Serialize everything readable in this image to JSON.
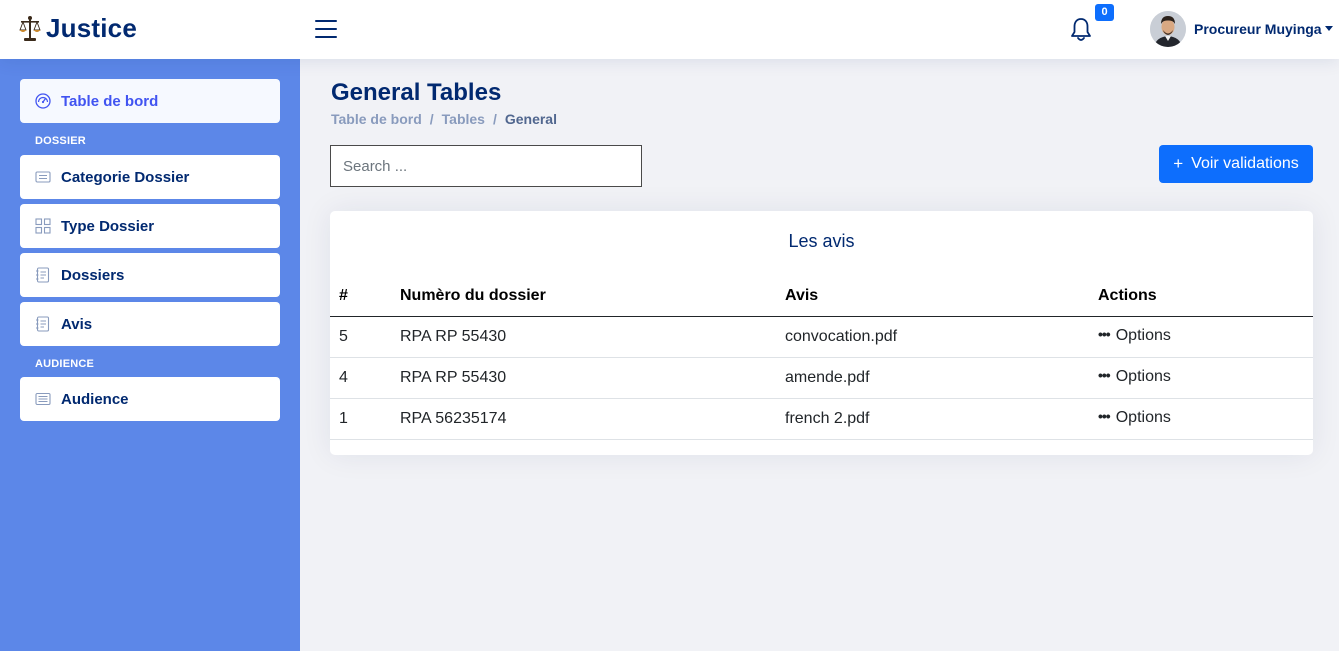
{
  "header": {
    "logo_text": "Justice",
    "notification_count": "0",
    "user_name": "Procureur Muyinga"
  },
  "sidebar": {
    "items": [
      {
        "label": "Table de bord",
        "icon": "gauge-icon",
        "active": true
      },
      {
        "label": "Categorie Dossier",
        "icon": "card-list-icon"
      },
      {
        "label": "Type Dossier",
        "icon": "grid-icon"
      },
      {
        "label": "Dossiers",
        "icon": "journal-text-icon"
      },
      {
        "label": "Avis",
        "icon": "journal-text-icon"
      },
      {
        "label": "Audience",
        "icon": "list-box-icon"
      }
    ],
    "headings": [
      "DOSSIER",
      "AUDIENCE"
    ]
  },
  "main": {
    "title": "General Tables",
    "breadcrumb": [
      "Table de bord",
      "Tables",
      "General"
    ],
    "search_placeholder": "Search ...",
    "action_button": {
      "icon": "plus-icon",
      "label": "Voir validations"
    },
    "card_title": "Les avis",
    "table": {
      "headers": [
        "#",
        "Numèro du dossier",
        "Avis",
        "Actions"
      ],
      "rows": [
        {
          "id": "5",
          "dossier": "RPA RP 55430",
          "avis": "convocation.pdf",
          "action": "Options"
        },
        {
          "id": "4",
          "dossier": "RPA RP 55430",
          "avis": "amende.pdf",
          "action": "Options"
        },
        {
          "id": "1",
          "dossier": "RPA 56235174",
          "avis": "french 2.pdf",
          "action": "Options"
        }
      ]
    }
  },
  "colors": {
    "brand": "#012970",
    "sidebar_bg": "#5c87e8",
    "primary": "#0d6efd",
    "page_bg": "#f1f2f6"
  }
}
